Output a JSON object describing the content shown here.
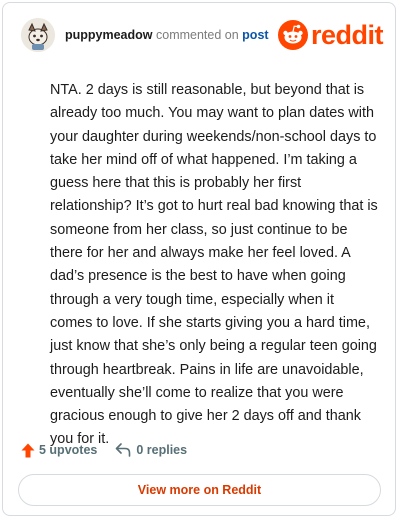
{
  "header": {
    "username": "puppymeadow",
    "action_text": "commented on",
    "post_link": "post",
    "brand": "reddit",
    "brand_color": "#ff4500"
  },
  "comment": {
    "text": "NTA. 2 days is still reasonable, but beyond that is already too much. You may want to plan dates with your daughter during weekends/non-school days to take her mind off of what happened. I’m taking a guess here that this is probably her first relationship? It’s got to hurt real bad knowing that is someone from her class, so just continue to be there for her and always make her feel loved. A dad’s presence is the best to have when going through a very tough time, especially when it comes to love. If she starts giving you a hard time, just know that she’s only being a regular teen going through heartbreak. Pains in life are unavoidable, eventually she’ll come to realize that you were gracious enough to give her 2 days off and thank you for it."
  },
  "actions": {
    "upvotes": "5 upvotes",
    "replies": "0 replies",
    "upvote_icon": "upvote-arrow-icon",
    "reply_icon": "reply-arrow-icon",
    "upvote_color": "#ff4500"
  },
  "footer": {
    "view_more": "View more on Reddit",
    "view_more_color": "#d93a00"
  }
}
